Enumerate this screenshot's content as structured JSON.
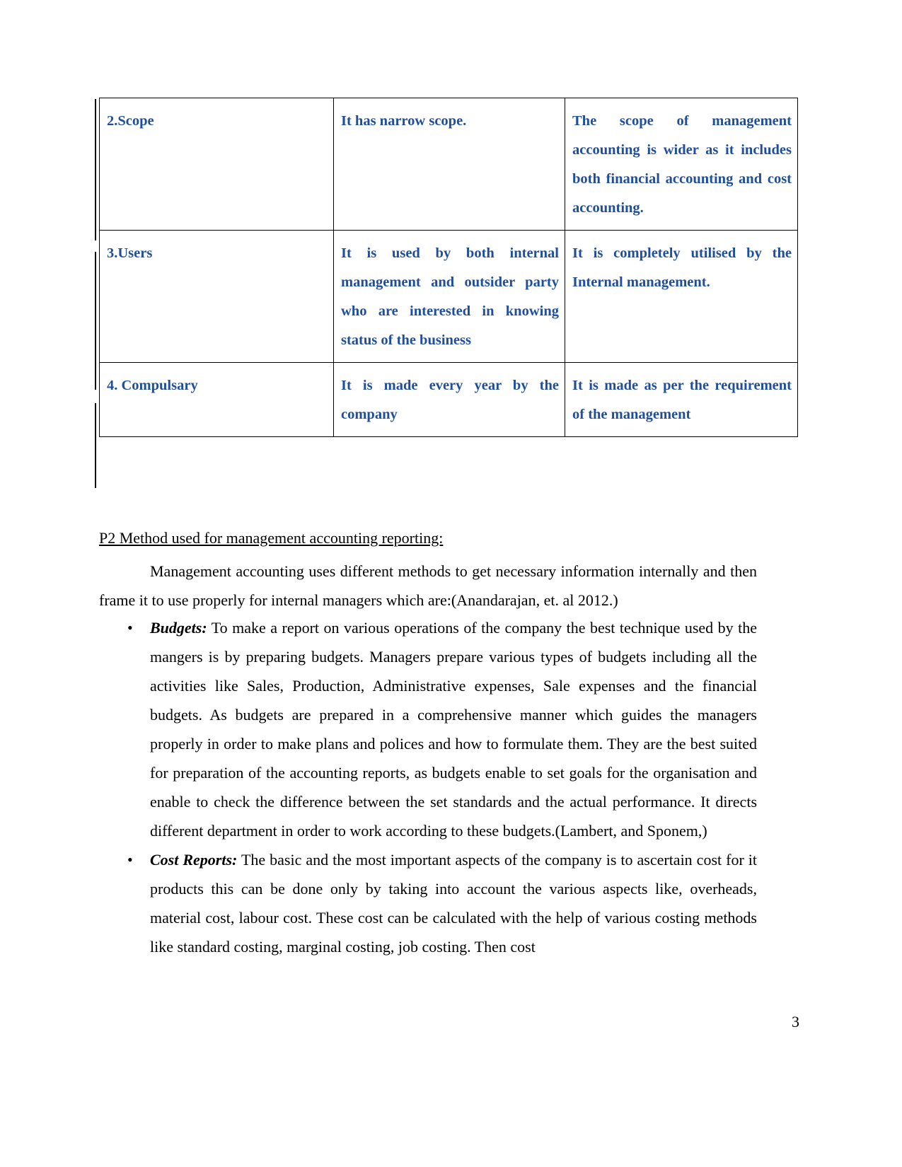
{
  "document": {
    "page_number": "3",
    "table": {
      "accent_color": "#1F4E9C",
      "rows": [
        {
          "label": "2.Scope",
          "col2": "It has narrow scope.",
          "col3": "The scope of management accounting is wider as it includes both financial accounting and cost accounting."
        },
        {
          "label": "3.Users",
          "col2": "It is used by both internal management and outsider party who are interested in knowing status of the business",
          "col3": "It is completely utilised by the Internal management."
        },
        {
          "label": "4. Compulsary",
          "col2": "It is made every year by the company",
          "col3": "It is made as per the requirement of the management"
        }
      ]
    },
    "section": {
      "heading": "P2 Method used for management accounting reporting:",
      "intro_paragraph": "Management accounting uses different methods to get necessary information internally and then frame it to use properly for internal managers which are:(Anandarajan, et. al 2012.)",
      "bullet_marker": "•",
      "bullets": [
        {
          "lead": "Budgets:",
          "text": " To make a report on various operations of the company the best technique used by the mangers is by preparing budgets. Managers prepare various types of budgets including all the activities like Sales, Production, Administrative expenses, Sale expenses and the financial budgets. As budgets are prepared in a comprehensive manner which guides the managers properly in order to make plans and polices and how to formulate them. They are the best suited for preparation of the accounting reports, as budgets enable to set goals for the organisation and enable to check the difference between the set standards and the actual performance. It directs different department in order to work according to these budgets.(Lambert, and Sponem,)"
        },
        {
          "lead": "Cost Reports:",
          "text": " The basic and the most important aspects of the company is to ascertain cost for it products this can be done only by taking into account the various aspects like, overheads, material cost, labour cost. These cost can be calculated with the help of various costing methods like standard costing, marginal costing, job costing. Then cost"
        }
      ]
    }
  }
}
